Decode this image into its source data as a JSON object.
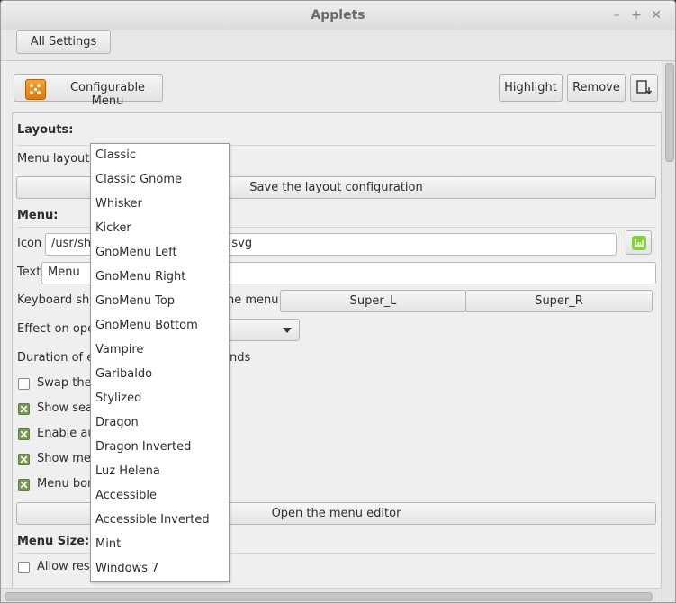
{
  "window": {
    "title": "Applets"
  },
  "toolbar": {
    "all_settings": "All Settings"
  },
  "applet": {
    "name": "Configurable Menu",
    "highlight": "Highlight",
    "remove": "Remove"
  },
  "layouts": {
    "title": "Layouts:",
    "menu_layout_label": "Menu layout:",
    "save_button": "Save the layout configuration"
  },
  "menu": {
    "title": "Menu:",
    "icon_label": "Icon",
    "icon_path_start": "/usr/sha",
    "icon_path_end": "u.svg",
    "text_label": "Text",
    "text_value": "Menu",
    "keyboard_label_start": "Keyboard sho",
    "keyboard_label_end": "he menu",
    "key1": "Super_L",
    "key2": "Super_R",
    "effect_label": "Effect on ope",
    "duration_label_start": "Duration of ef",
    "duration_label_end": "nds",
    "checks": [
      {
        "label": "Swap the",
        "checked": false
      },
      {
        "label": "Show sear",
        "checked": true
      },
      {
        "label": "Enable au",
        "checked": true
      },
      {
        "label": "Show mer",
        "checked": true
      },
      {
        "label": "Menu bord",
        "checked": true
      }
    ],
    "editor_button": "Open the menu editor"
  },
  "menu_size": {
    "title": "Menu Size:",
    "checks": [
      {
        "label": "Allow resiz",
        "checked": false
      }
    ]
  },
  "layout_options": [
    "Classic",
    "Classic Gnome",
    "Whisker",
    "Kicker",
    "GnoMenu Left",
    "GnoMenu Right",
    "GnoMenu Top",
    "GnoMenu Bottom",
    "Vampire",
    "Garibaldo",
    "Stylized",
    "Dragon",
    "Dragon Inverted",
    "Luz Helena",
    "Accessible",
    "Accessible Inverted",
    "Mint",
    "Windows 7"
  ]
}
